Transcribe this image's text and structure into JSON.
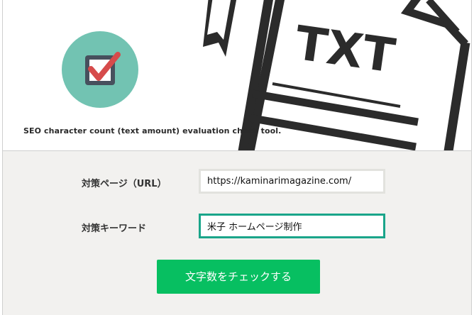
{
  "banner": {
    "caption": "SEO character count (text amount) evaluation check tool.",
    "document_text": "TXT",
    "logo_icon": "checkbox-check-icon",
    "document_icon": "txt-document-icon",
    "colors": {
      "logo_circle": "#72c3b2",
      "logo_box": "#47505d",
      "check_mark": "#d64b4b",
      "document_stroke": "#2b2b2b"
    }
  },
  "form": {
    "url_label": "対策ページ（URL）",
    "url_value": "https://kaminarimagazine.com/",
    "keyword_label": "対策キーワード",
    "keyword_value": "米子 ホームページ制作",
    "submit_label": "文字数をチェックする",
    "colors": {
      "button": "#07bf61",
      "focus_border": "#1aa58a",
      "background": "#f2f1ef"
    }
  }
}
